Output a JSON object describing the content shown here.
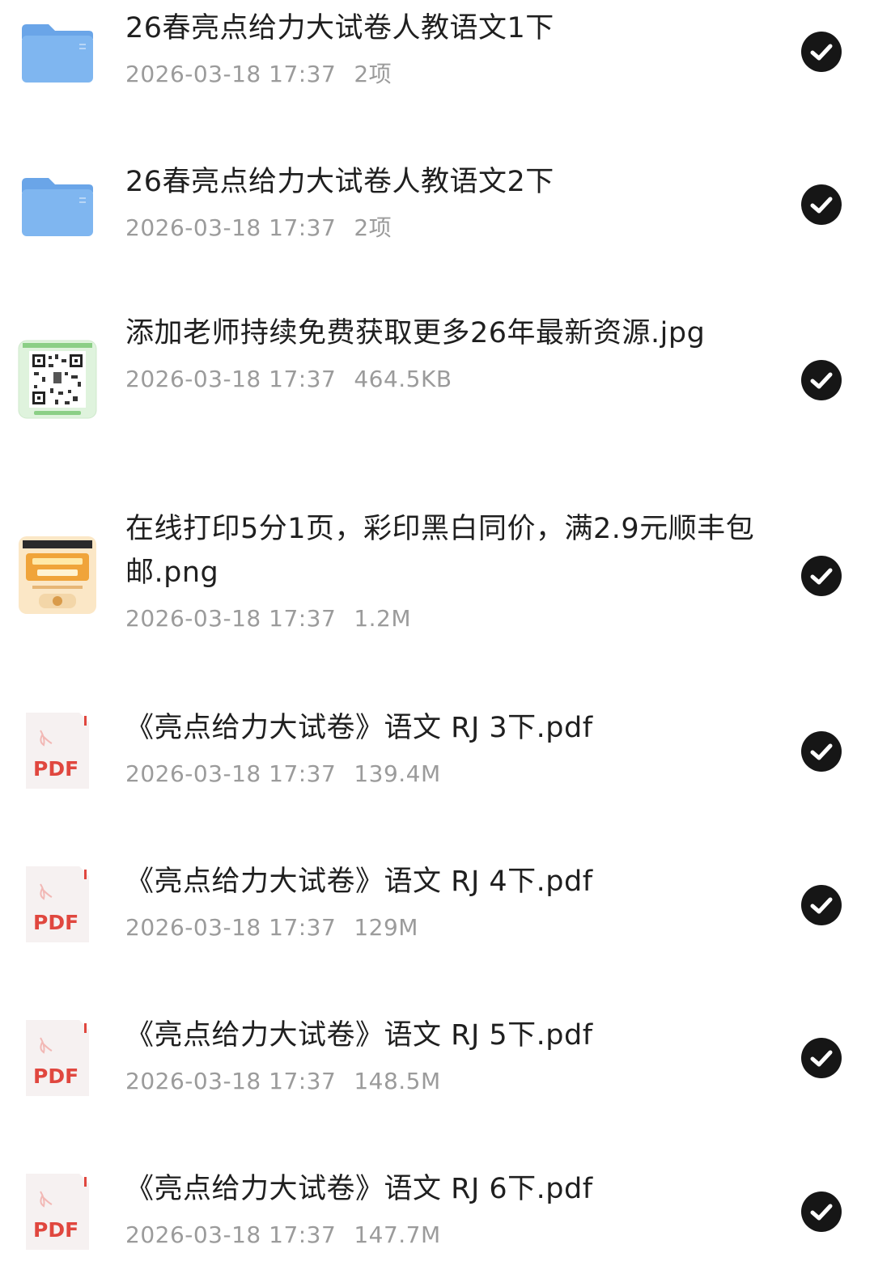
{
  "files": [
    {
      "name": "26春亮点给力大试卷人教语文1下",
      "date": "2026-03-18 17:37",
      "size": "2项",
      "icon": "folder-icon",
      "selected": true
    },
    {
      "name": "26春亮点给力大试卷人教语文2下",
      "date": "2026-03-18 17:37",
      "size": "2项",
      "icon": "folder-icon",
      "selected": true
    },
    {
      "name": "添加老师持续免费获取更多26年最新资源.jpg",
      "date": "2026-03-18 17:37",
      "size": "464.5KB",
      "icon": "qr-image-thumbnail",
      "selected": true
    },
    {
      "name": "在线打印5分1页，彩印黑白同价，满2.9元顺丰包邮.png",
      "date": "2026-03-18 17:37",
      "size": "1.2M",
      "icon": "promo-image-thumbnail",
      "selected": true
    },
    {
      "name": "《亮点给力大试卷》语文 RJ 3下.pdf",
      "date": "2026-03-18 17:37",
      "size": "139.4M",
      "icon": "pdf-icon",
      "selected": true
    },
    {
      "name": "《亮点给力大试卷》语文 RJ 4下.pdf",
      "date": "2026-03-18 17:37",
      "size": "129M",
      "icon": "pdf-icon",
      "selected": true
    },
    {
      "name": "《亮点给力大试卷》语文 RJ 5下.pdf",
      "date": "2026-03-18 17:37",
      "size": "148.5M",
      "icon": "pdf-icon",
      "selected": true
    },
    {
      "name": "《亮点给力大试卷》语文 RJ 6下.pdf",
      "date": "2026-03-18 17:37",
      "size": "147.7M",
      "icon": "pdf-icon",
      "selected": true
    }
  ],
  "pdf_badge": "PDF",
  "colors": {
    "folder": "#7fb6f0",
    "folder_dark": "#6aa5e8",
    "pdf_red": "#e0473f",
    "check_bg": "#161616",
    "meta_text": "#9b9b9b"
  }
}
